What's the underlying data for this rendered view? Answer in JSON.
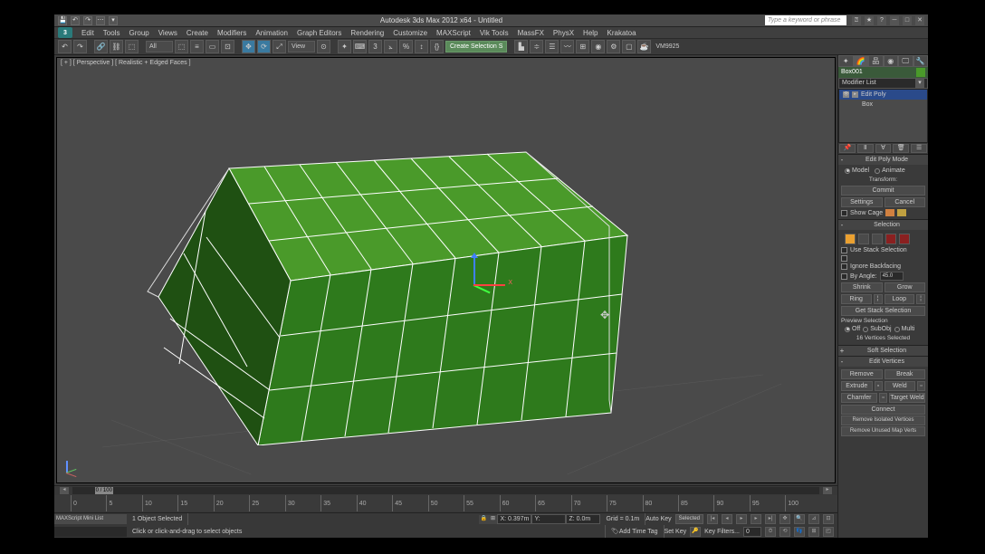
{
  "titlebar": {
    "title": "Autodesk 3ds Max 2012 x64 - Untitled",
    "search_placeholder": "Type a keyword or phrase"
  },
  "menubar": [
    "Edit",
    "Tools",
    "Group",
    "Views",
    "Create",
    "Modifiers",
    "Animation",
    "Graph Editors",
    "Rendering",
    "Customize",
    "MAXScript",
    "Vik Tools",
    "MassFX",
    "PhysX",
    "Help",
    "Krakatoa"
  ],
  "toolbar": {
    "all": "All",
    "view": "View",
    "create_sel": "Create Selection S",
    "vm_label": "VM9925"
  },
  "viewport": {
    "label": "[ + ] [ Perspective ] [ Realistic + Edged Faces ]"
  },
  "timeline": {
    "slider": "0 / 100",
    "ticks": [
      "0",
      "5",
      "10",
      "15",
      "20",
      "25",
      "30",
      "35",
      "40",
      "45",
      "50",
      "55",
      "60",
      "65",
      "70",
      "75",
      "80",
      "85",
      "90",
      "95",
      "100"
    ]
  },
  "status": {
    "maxscript": "MAXScript Mini List",
    "objects": "1 Object Selected",
    "prompt": "Click or click-and-drag to select objects",
    "x": "X: 0.397m",
    "y": "Y:",
    "z": "Z: 0.0m",
    "grid": "Grid = 0.1m",
    "add_time_tag": "Add Time Tag",
    "auto_key": "Auto Key",
    "set_key": "Set Key",
    "selected": "Selected",
    "key_filters": "Key Filters..."
  },
  "panel": {
    "obj_name": "Box001",
    "modifier_list": "Modifier List",
    "stack": {
      "edit_poly": "Edit Poly",
      "box": "Box"
    },
    "edit_poly_mode": {
      "title": "Edit Poly Mode",
      "model": "Model",
      "animate": "Animate",
      "transform": "Transform:",
      "commit": "Commit",
      "settings": "Settings",
      "cancel": "Cancel",
      "show_cage": "Show Cage"
    },
    "selection": {
      "title": "Selection",
      "use_stack": "Use Stack Selection",
      "ignore_back": "Ignore Backfacing",
      "by_angle": "By Angle:",
      "angle_val": "45.0",
      "shrink": "Shrink",
      "grow": "Grow",
      "ring": "Ring",
      "loop": "Loop",
      "get_stack": "Get Stack Selection",
      "preview": "Preview Selection",
      "off": "Off",
      "subobj": "SubObj",
      "multi": "Multi",
      "status": "16 Vertices Selected"
    },
    "soft": {
      "title": "Soft Selection"
    },
    "edit_verts": {
      "title": "Edit Vertices",
      "remove": "Remove",
      "break": "Break",
      "extrude": "Extrude",
      "weld": "Weld",
      "chamfer": "Chamfer",
      "target_weld": "Target Weld",
      "connect": "Connect",
      "remove_iso": "Remove Isolated Vertices",
      "remove_unused": "Remove Unused Map Verts"
    }
  }
}
